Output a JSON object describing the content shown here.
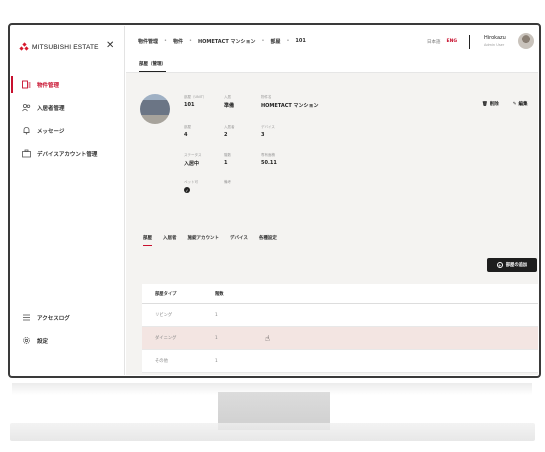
{
  "brand": {
    "logo_text": "MITSUBISHI ESTATE",
    "accent": "#c8102e"
  },
  "sidebar": {
    "items": [
      {
        "label": "物件管理",
        "icon": "building-list-icon",
        "active": true
      },
      {
        "label": "入居者管理",
        "icon": "users-icon",
        "active": false
      },
      {
        "label": "メッセージ",
        "icon": "bell-icon",
        "active": false
      },
      {
        "label": "デバイスアカウント管理",
        "icon": "device-account-icon",
        "active": false
      }
    ],
    "bottom_items": [
      {
        "label": "アクセスログ",
        "icon": "list-icon"
      },
      {
        "label": "設定",
        "icon": "gear-icon"
      }
    ]
  },
  "header": {
    "breadcrumb": [
      "物件管理",
      "物件",
      "HOMETACT マンション",
      "部屋",
      "101"
    ],
    "lang_ja": "日本語",
    "lang_en": "ENG",
    "user_name": "Hirokazu",
    "user_role": "Admin User"
  },
  "subtab": {
    "label": "部屋（管理）"
  },
  "unit": {
    "fields": [
      {
        "label": "部屋（UNIT）",
        "value": "101"
      },
      {
        "label": "入居",
        "value": "準備"
      },
      {
        "label": "物件名",
        "value": "HOMETACT マンション"
      },
      {
        "label": "部屋",
        "value": "4"
      },
      {
        "label": "入居者",
        "value": "2"
      },
      {
        "label": "デバイス",
        "value": "3"
      },
      {
        "label": "ステータス",
        "value": "入居中"
      },
      {
        "label": "階数",
        "value": "1"
      },
      {
        "label": "専有面積",
        "value": "50.11"
      },
      {
        "label": "ペット可",
        "value": "✓"
      },
      {
        "label": "備考",
        "value": ""
      }
    ],
    "actions": {
      "edit": "編集",
      "delete": "削除"
    }
  },
  "tabs": [
    "部屋",
    "入居者",
    "施錠アカウント",
    "デバイス",
    "各種設定"
  ],
  "add_button": {
    "label": "部屋の追加"
  },
  "table": {
    "headers": [
      "部屋タイプ",
      "階数"
    ],
    "rows": [
      {
        "type": "リビング",
        "count": "1"
      },
      {
        "type": "ダイニング",
        "count": "1"
      },
      {
        "type": "その他",
        "count": "1"
      }
    ]
  }
}
